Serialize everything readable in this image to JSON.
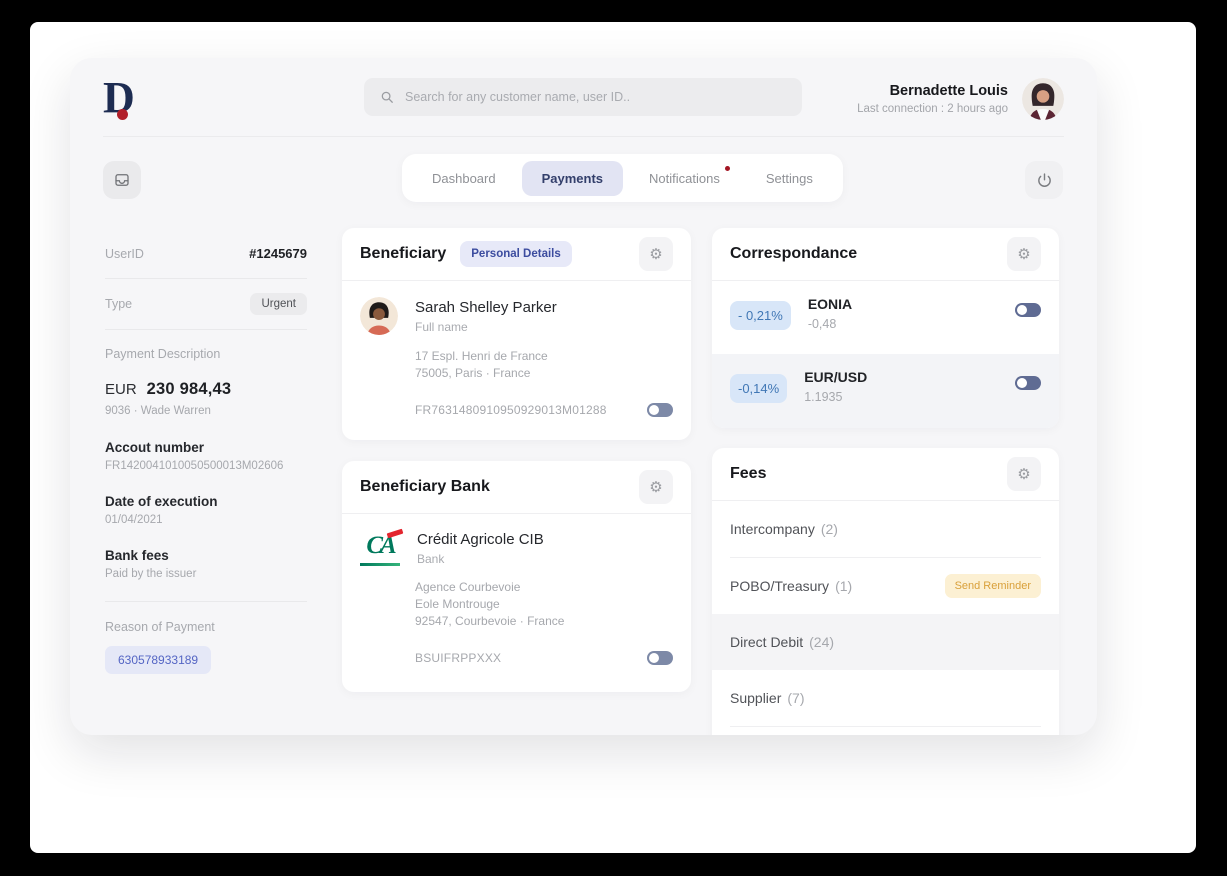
{
  "header": {
    "logo_letter": "D",
    "search_placeholder": "Search for any customer name, user ID..",
    "user_name": "Bernadette Louis",
    "last_connection": "Last connection : 2 hours ago"
  },
  "nav": {
    "tabs": [
      {
        "label": "Dashboard",
        "active": false
      },
      {
        "label": "Payments",
        "active": true
      },
      {
        "label": "Notifications",
        "active": false,
        "has_dot": true
      },
      {
        "label": "Settings",
        "active": false
      }
    ]
  },
  "sidebar": {
    "user_id_label": "UserID",
    "user_id_value": "#1245679",
    "type_label": "Type",
    "type_value": "Urgent",
    "payment_description_label": "Payment Description",
    "currency": "EUR",
    "amount": "230 984,43",
    "payment_meta": "9036  ·  Wade Warren",
    "account_number_label": "Accout number",
    "account_number_value": "FR1420041010050500013M02606",
    "date_of_execution_label": "Date of execution",
    "date_of_execution_value": "01/04/2021",
    "bank_fees_label": "Bank fees",
    "bank_fees_value": "Paid by the issuer",
    "reason_label": "Reason of Payment",
    "reason_value": "630578933189"
  },
  "cards": {
    "beneficiary": {
      "title": "Beneficiary",
      "badge": "Personal Details",
      "name": "Sarah Shelley Parker",
      "name_caption": "Full name",
      "address_line1": "17 Espl. Henri de France",
      "address_line2": "75005, Paris  ·  France",
      "iban": "FR7631480910950929013M01288"
    },
    "beneficiary_bank": {
      "title": "Beneficiary Bank",
      "logo_text": "CA",
      "bank_name": "Crédit Agricole CIB",
      "bank_caption": "Bank",
      "address_line1": "Agence Courbevoie",
      "address_line2": "Eole Montrouge",
      "address_line3": "92547, Courbevoie  ·  France",
      "bic": "BSUIFRPPXXX"
    },
    "correspondance": {
      "title": "Correspondance",
      "rows": [
        {
          "badge": "- 0,21%",
          "name": "EONIA",
          "value": "-0,48"
        },
        {
          "badge": "-0,14%",
          "name": "EUR/USD",
          "value": "1.1935"
        }
      ]
    },
    "fees": {
      "title": "Fees",
      "rows": [
        {
          "label": "Intercompany",
          "count": "(2)"
        },
        {
          "label": "POBO/Treasury",
          "count": "(1)",
          "badge": "Send Reminder"
        },
        {
          "label": "Direct Debit",
          "count": "(24)",
          "highlighted": true
        },
        {
          "label": "Supplier",
          "count": "(7)"
        }
      ]
    }
  },
  "icons": {
    "gear": "⚙"
  },
  "colors": {
    "navy_logo": "#1d2c52",
    "logo_dot_red": "#b11f2a",
    "active_tab_bg": "#e2e4f3",
    "active_tab_text": "#333f6b",
    "notification_dot": "#a31523",
    "rate_badge_bg": "#d8e6f8",
    "rate_badge_text": "#4077b5",
    "reminder_badge_bg": "#fcf0d3",
    "reminder_badge_text": "#d9a03a",
    "reason_badge_bg": "#e5e8f7",
    "reason_badge_text": "#5465c4",
    "toggle_track": "#5f6b93",
    "ca_green": "#00795c",
    "ca_red": "#e3252e"
  }
}
